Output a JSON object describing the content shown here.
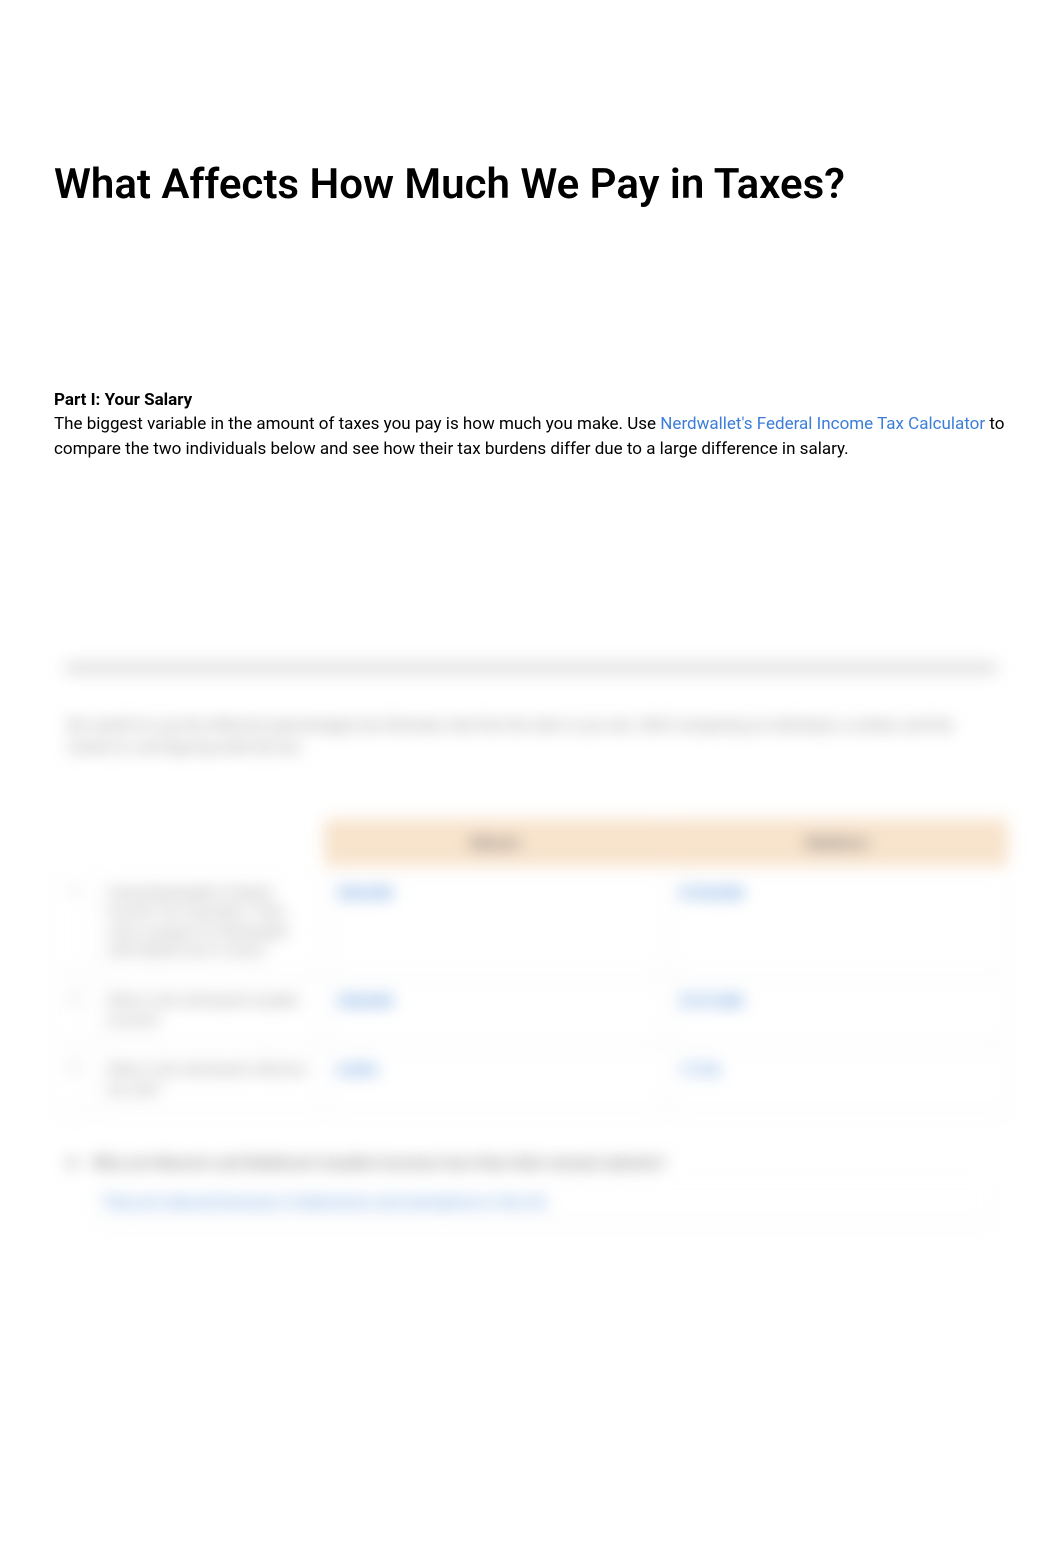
{
  "title": "What Affects How Much We Pay in Taxes?",
  "part1": {
    "heading": "Part I: Your Salary",
    "intro_before_link": "The biggest variable in the amount of taxes you pay is how much you make. Use ",
    "link_text": "Nerdwallet's Federal Income Tax Calculator",
    "intro_after_link": " to compare the two individuals below and see how their tax burdens differ due to a large difference in salary."
  },
  "blurred": {
    "paragraph": "Be careful to use the effective (percentage) tax Estimate, that this the ratio in you see. We'll comparing an individual, a worker, and the lowest to, and figuring what the tax",
    "table": {
      "headers": [
        "Mason",
        "Madison"
      ],
      "rows": [
        {
          "num": "1",
          "label": "Using Nerdwallet's Federal Income Tax Calculator. Then, click compare for Nerdwallet, with details how in every?",
          "val1": "$50,000",
          "val2": "$150,000"
        },
        {
          "num": "2",
          "label": "What is the individual's taxable income?",
          "val1": "$38,000",
          "val2": "$137,000"
        },
        {
          "num": "3",
          "label": "What is the individual's effective tax rate?",
          "val1": "8.00%",
          "val2": "17.5%"
        }
      ]
    },
    "question": "Why are Mason's and Madison's taxable incomes less than their annual salaries?",
    "answer": "They are reduced because of deductions and exemptions in the US."
  }
}
